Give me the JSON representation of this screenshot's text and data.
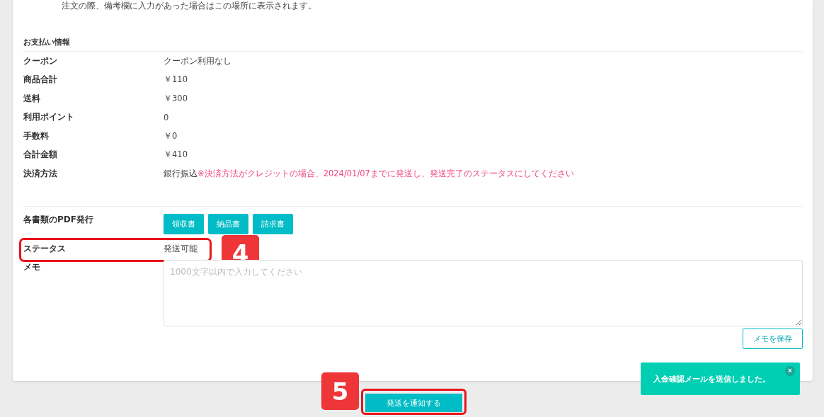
{
  "note": "注文の際、備考欄に入力があった場合はこの場所に表示されます。",
  "payment": {
    "title": "お支払い情報",
    "rows": [
      {
        "label": "クーポン",
        "value": "クーポン利用なし"
      },
      {
        "label": "商品合計",
        "value": "￥110"
      },
      {
        "label": "送料",
        "value": "￥300"
      },
      {
        "label": "利用ポイント",
        "value": "0"
      },
      {
        "label": "手数料",
        "value": "￥0"
      },
      {
        "label": "合計金額",
        "value": "￥410"
      },
      {
        "label": "決済方法",
        "value": "銀行振込",
        "warning": "※決済方法がクレジットの場合、2024/01/07までに発送し、発送完了のステータスにしてください"
      }
    ]
  },
  "pdf": {
    "label": "各書類のPDF発行",
    "buttons": [
      "領収書",
      "納品書",
      "請求書"
    ]
  },
  "status": {
    "label": "ステータス",
    "value": "発送可能",
    "badge": "4"
  },
  "memo": {
    "label": "メモ",
    "placeholder": "1000文字以内で入力してください",
    "save_button": "メモを保存"
  },
  "notify_button": {
    "label": "発送を通知する",
    "badge": "5"
  },
  "toast": {
    "message": "入金確認メールを送信しました。",
    "close": "×"
  }
}
